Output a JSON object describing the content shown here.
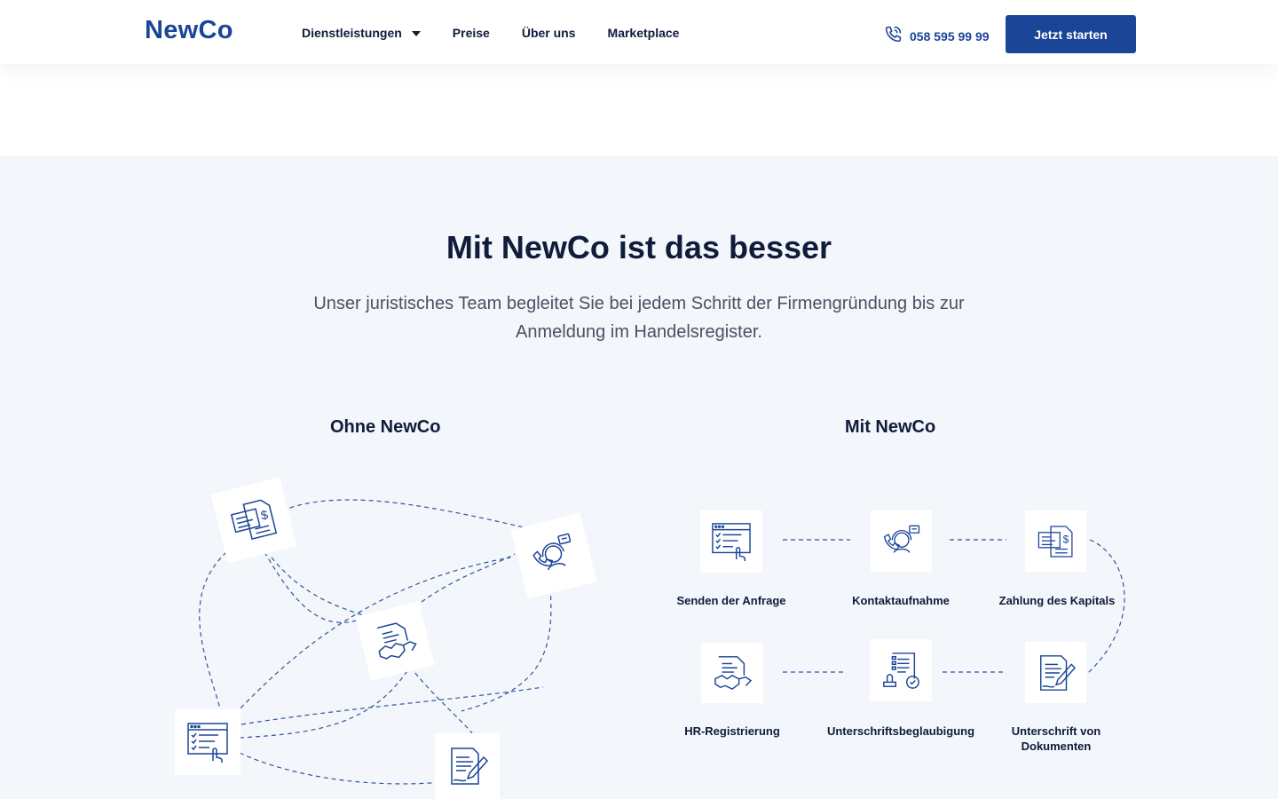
{
  "header": {
    "logo": "NewCo",
    "nav": [
      {
        "label": "Dienstleistungen",
        "has_dropdown": true
      },
      {
        "label": "Preise"
      },
      {
        "label": "Über uns"
      },
      {
        "label": "Marketplace"
      }
    ],
    "phone": "058 595 99 99",
    "cta_label": "Jetzt starten"
  },
  "section": {
    "title": "Mit NewCo ist das besser",
    "subtitle": "Unser juristisches Team begleitet Sie bei jedem Schritt der Firmengründung bis zur Anmeldung im Handelsregister.",
    "left_title": "Ohne NewCo",
    "right_title": "Mit NewCo",
    "steps": [
      {
        "label": "Senden der Anfrage",
        "icon": "form-click-icon"
      },
      {
        "label": "Kontaktaufnahme",
        "icon": "support-agent-icon"
      },
      {
        "label": "Zahlung des Kapitals",
        "icon": "invoice-dollar-icon"
      },
      {
        "label": "HR-Registrierung",
        "icon": "handshake-document-icon"
      },
      {
        "label": "Unterschriftsbeglaubigung",
        "icon": "stamp-document-icon"
      },
      {
        "label": "Unterschrift von Dokumenten",
        "icon": "document-pen-icon"
      }
    ]
  },
  "colors": {
    "brand": "#1b4597",
    "text": "#0f1c3a",
    "muted": "#4a5163",
    "section_bg": "#f3f6fa"
  }
}
